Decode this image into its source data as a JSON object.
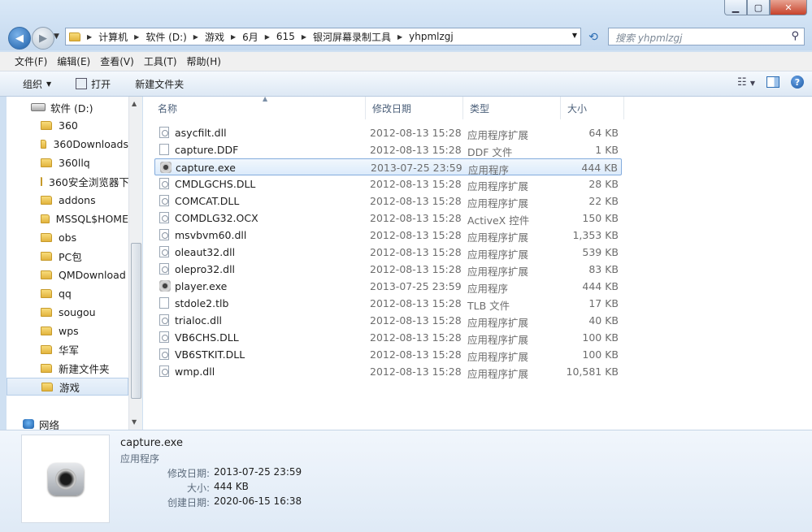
{
  "address": {
    "crumbs": [
      "计算机",
      "软件 (D:)",
      "游戏",
      "6月",
      "615",
      "银河屏幕录制工具",
      "yhpmlzgj"
    ]
  },
  "search": {
    "placeholder": "搜索 yhpmlzgj"
  },
  "menubar": [
    "文件(F)",
    "编辑(E)",
    "查看(V)",
    "工具(T)",
    "帮助(H)"
  ],
  "toolbar": {
    "organize": "组织",
    "open": "打开",
    "new_folder": "新建文件夹"
  },
  "nav": {
    "drive": "软件 (D:)",
    "folders": [
      "360",
      "360Downloads",
      "360llq",
      "360安全浏览器下",
      "addons",
      "MSSQL$HOME",
      "obs",
      "PC包",
      "QMDownload",
      "qq",
      "sougou",
      "wps",
      "华军",
      "新建文件夹",
      "游戏"
    ],
    "network": "网络"
  },
  "columns": {
    "name": "名称",
    "date": "修改日期",
    "type": "类型",
    "size": "大小"
  },
  "files": [
    {
      "name": "asycfilt.dll",
      "date": "2012-08-13 15:28",
      "type": "应用程序扩展",
      "size": "64 KB",
      "icon": "dll"
    },
    {
      "name": "capture.DDF",
      "date": "2012-08-13 15:28",
      "type": "DDF 文件",
      "size": "1 KB",
      "icon": "file"
    },
    {
      "name": "capture.exe",
      "date": "2013-07-25 23:59",
      "type": "应用程序",
      "size": "444 KB",
      "icon": "exe"
    },
    {
      "name": "CMDLGCHS.DLL",
      "date": "2012-08-13 15:28",
      "type": "应用程序扩展",
      "size": "28 KB",
      "icon": "dll"
    },
    {
      "name": "COMCAT.DLL",
      "date": "2012-08-13 15:28",
      "type": "应用程序扩展",
      "size": "22 KB",
      "icon": "dll"
    },
    {
      "name": "COMDLG32.OCX",
      "date": "2012-08-13 15:28",
      "type": "ActiveX 控件",
      "size": "150 KB",
      "icon": "dll"
    },
    {
      "name": "msvbvm60.dll",
      "date": "2012-08-13 15:28",
      "type": "应用程序扩展",
      "size": "1,353 KB",
      "icon": "dll"
    },
    {
      "name": "oleaut32.dll",
      "date": "2012-08-13 15:28",
      "type": "应用程序扩展",
      "size": "539 KB",
      "icon": "dll"
    },
    {
      "name": "olepro32.dll",
      "date": "2012-08-13 15:28",
      "type": "应用程序扩展",
      "size": "83 KB",
      "icon": "dll"
    },
    {
      "name": "player.exe",
      "date": "2013-07-25 23:59",
      "type": "应用程序",
      "size": "444 KB",
      "icon": "exe"
    },
    {
      "name": "stdole2.tlb",
      "date": "2012-08-13 15:28",
      "type": "TLB 文件",
      "size": "17 KB",
      "icon": "file"
    },
    {
      "name": "trialoc.dll",
      "date": "2012-08-13 15:28",
      "type": "应用程序扩展",
      "size": "40 KB",
      "icon": "dll"
    },
    {
      "name": "VB6CHS.DLL",
      "date": "2012-08-13 15:28",
      "type": "应用程序扩展",
      "size": "100 KB",
      "icon": "dll"
    },
    {
      "name": "VB6STKIT.DLL",
      "date": "2012-08-13 15:28",
      "type": "应用程序扩展",
      "size": "100 KB",
      "icon": "dll"
    },
    {
      "name": "wmp.dll",
      "date": "2012-08-13 15:28",
      "type": "应用程序扩展",
      "size": "10,581 KB",
      "icon": "dll"
    }
  ],
  "details": {
    "name": "capture.exe",
    "type": "应用程序",
    "modified_label": "修改日期:",
    "modified": "2013-07-25 23:59",
    "size_label": "大小:",
    "size": "444 KB",
    "created_label": "创建日期:",
    "created": "2020-06-15 16:38"
  }
}
